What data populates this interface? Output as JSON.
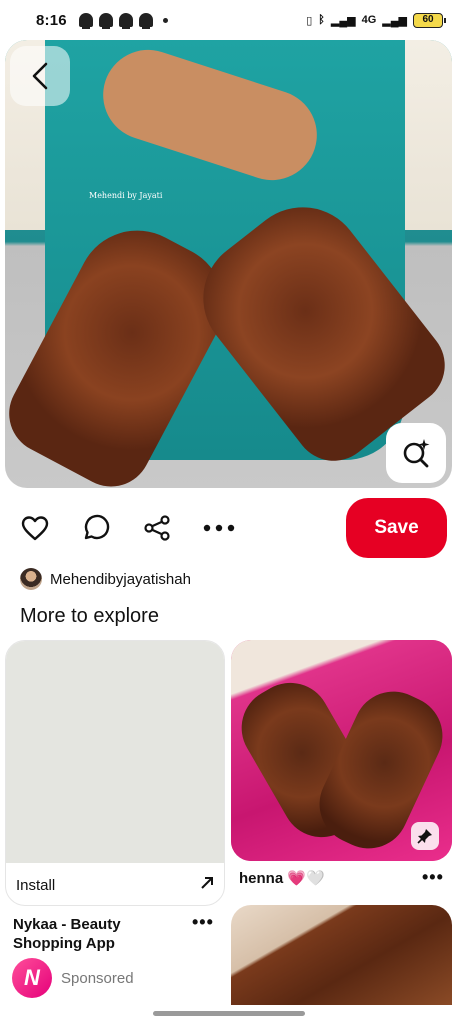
{
  "status_bar": {
    "time": "8:16",
    "network": "4G",
    "battery": "60"
  },
  "pin": {
    "watermark": "Mehendi by Jayati",
    "creator_name": "Mehendibyjayatishah",
    "save_label": "Save"
  },
  "explore": {
    "title": "More to explore"
  },
  "ad_card": {
    "install_label": "Install",
    "title": "Nykaa - Beauty Shopping App",
    "logo_letter": "N",
    "sponsored_label": "Sponsored"
  },
  "henna_card": {
    "title": "henna 💗🤍"
  },
  "more_label": "•••",
  "colors": {
    "save": "#e60023",
    "background": "#ffffff"
  }
}
